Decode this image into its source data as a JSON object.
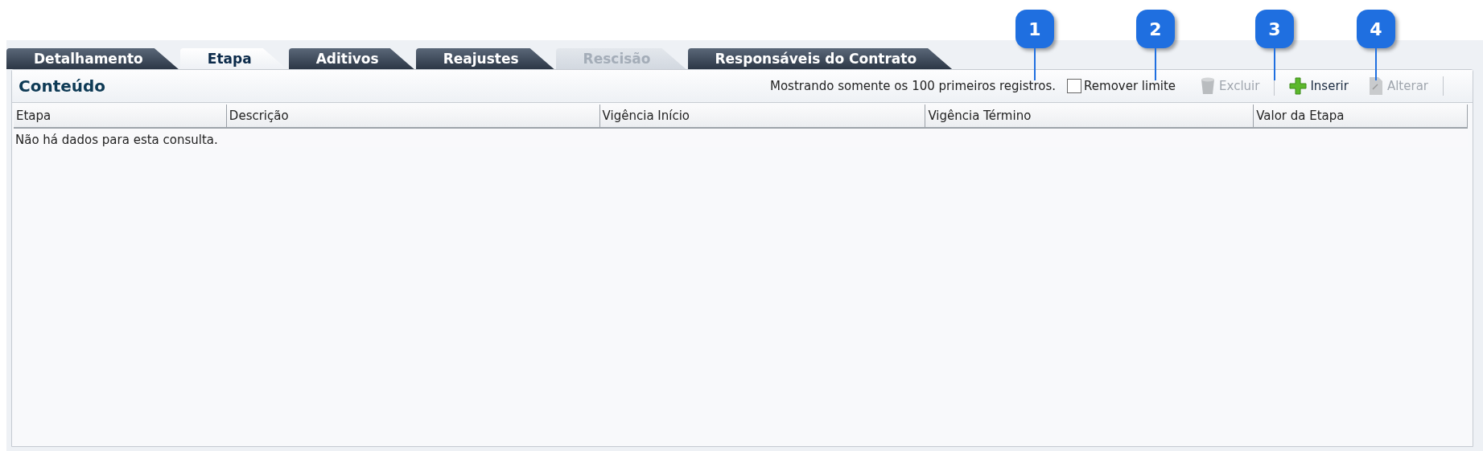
{
  "tabs": [
    {
      "label": "Detalhamento",
      "selected": false,
      "disabled": false
    },
    {
      "label": "Etapa",
      "selected": true,
      "disabled": false
    },
    {
      "label": "Aditivos",
      "selected": false,
      "disabled": false
    },
    {
      "label": "Reajustes",
      "selected": false,
      "disabled": false
    },
    {
      "label": "Rescisão",
      "selected": false,
      "disabled": true
    },
    {
      "label": "Responsáveis do Contrato",
      "selected": false,
      "disabled": false
    }
  ],
  "panel": {
    "title": "Conteúdo",
    "notice": "Mostrando somente os 100 primeiros registros.",
    "remove_limit": {
      "label": "Remover limite",
      "checked": false
    },
    "actions": [
      {
        "kind": "delete",
        "label": "Excluir",
        "disabled": true
      },
      {
        "kind": "insert",
        "label": "Inserir",
        "disabled": false
      },
      {
        "kind": "edit",
        "label": "Alterar",
        "disabled": true
      }
    ]
  },
  "table": {
    "columns": [
      "Etapa",
      "Descrição",
      "Vigência Início",
      "Vigência Término",
      "Valor da Etapa"
    ],
    "empty_message": "Não há dados para esta consulta."
  },
  "callouts": [
    {
      "label": "1"
    },
    {
      "label": "2"
    },
    {
      "label": "3"
    },
    {
      "label": "4"
    }
  ]
}
